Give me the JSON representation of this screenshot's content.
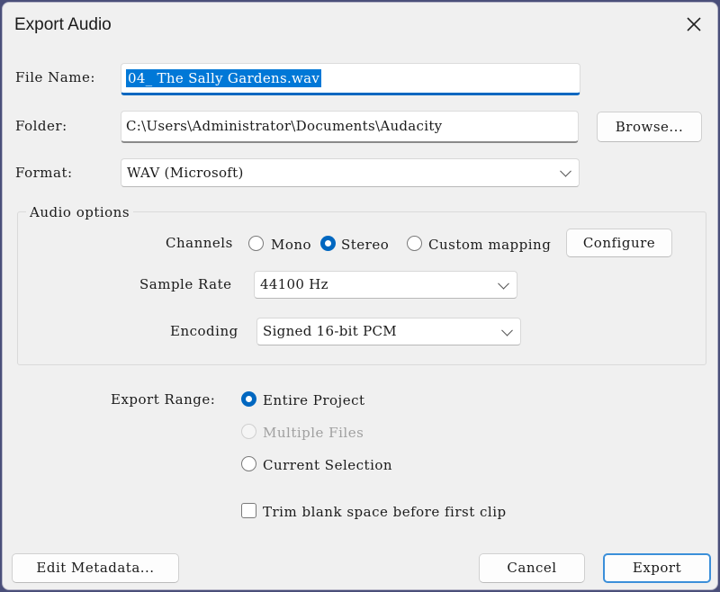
{
  "window": {
    "title": "Export Audio",
    "close_icon": "close-icon"
  },
  "file_name": {
    "label": "File Name:",
    "value": "04_ The Sally Gardens.wav"
  },
  "folder": {
    "label": "Folder:",
    "value": "C:\\Users\\Administrator\\Documents\\Audacity",
    "browse_label": "Browse..."
  },
  "format": {
    "label": "Format:",
    "value": "WAV (Microsoft)"
  },
  "audio_options": {
    "legend": "Audio options",
    "channels": {
      "label": "Channels",
      "options": [
        {
          "label": "Mono",
          "selected": false
        },
        {
          "label": "Stereo",
          "selected": true
        },
        {
          "label": "Custom mapping",
          "selected": false
        }
      ],
      "configure_label": "Configure"
    },
    "sample_rate": {
      "label": "Sample Rate",
      "value": "44100 Hz"
    },
    "encoding": {
      "label": "Encoding",
      "value": "Signed 16-bit PCM"
    }
  },
  "export_range": {
    "label": "Export Range:",
    "options": [
      {
        "label": "Entire Project",
        "selected": true,
        "disabled": false
      },
      {
        "label": "Multiple Files",
        "selected": false,
        "disabled": true
      },
      {
        "label": "Current Selection",
        "selected": false,
        "disabled": false
      }
    ],
    "trim": {
      "label": "Trim blank space before first clip",
      "checked": false
    }
  },
  "buttons": {
    "edit_metadata": "Edit Metadata...",
    "cancel": "Cancel",
    "export": "Export"
  },
  "colors": {
    "accent": "#0067c0",
    "selection": "#0078d7",
    "dialog_bg": "#f0f0f0"
  }
}
